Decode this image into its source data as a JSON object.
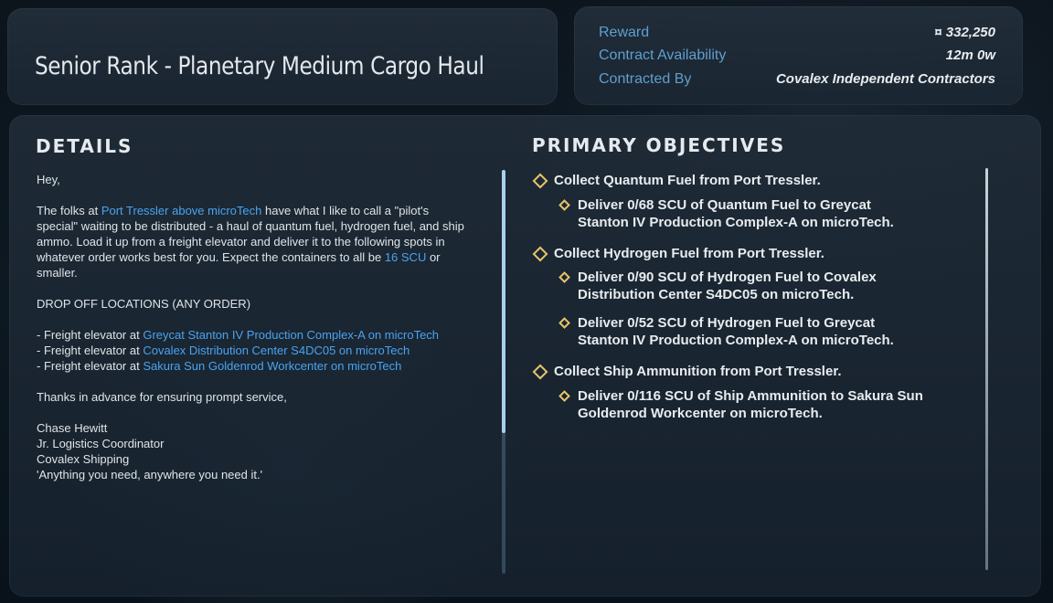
{
  "title": "Senior Rank - Planetary Medium Cargo Haul",
  "info": {
    "reward_label": "Reward",
    "reward_value": "¤ 332,250",
    "availability_label": "Contract Availability",
    "availability_value": "12m 0w",
    "contracted_by_label": "Contracted By",
    "contracted_by_value": "Covalex Independent Contractors"
  },
  "details": {
    "heading": "DETAILS",
    "greeting": "Hey,",
    "p1_a": "The folks at ",
    "p1_link1": "Port Tressler above microTech",
    "p1_b": " have what I like to call a \"pilot's special\" waiting to be distributed - a haul of quantum fuel, hydrogen fuel, and ship ammo. Load it up from a freight elevator and deliver it to the following spots in whatever order works best for you. Expect the containers to all be ",
    "p1_link2": "16 SCU",
    "p1_c": " or smaller.",
    "dropoff_heading": "DROP OFF LOCATIONS (ANY ORDER)",
    "loc_prefix": "- Freight elevator at ",
    "loc1": "Greycat Stanton IV Production Complex-A on microTech",
    "loc2": "Covalex Distribution Center S4DC05 on microTech",
    "loc3": "Sakura Sun Goldenrod Workcenter on microTech",
    "thanks": "Thanks in advance for ensuring prompt service,",
    "sig_name": "Chase Hewitt",
    "sig_title": "Jr. Logistics Coordinator",
    "sig_company": "Covalex Shipping",
    "sig_motto": "'Anything you need, anywhere you need it.'"
  },
  "objectives": {
    "heading": "PRIMARY OBJECTIVES",
    "items": [
      {
        "label": "Collect Quantum Fuel from Port Tressler.",
        "subs": [
          "Deliver 0/68 SCU of Quantum Fuel to Greycat Stanton IV Production Complex-A on microTech."
        ]
      },
      {
        "label": "Collect Hydrogen Fuel from Port Tressler.",
        "subs": [
          "Deliver 0/90 SCU of Hydrogen Fuel to Covalex Distribution Center S4DC05 on microTech.",
          "Deliver 0/52 SCU of Hydrogen Fuel to Greycat Stanton IV Production Complex-A on microTech."
        ]
      },
      {
        "label": "Collect Ship Ammunition from Port Tressler.",
        "subs": [
          "Deliver 0/116 SCU of Ship Ammunition to Sakura Sun Goldenrod Workcenter on microTech."
        ]
      }
    ]
  },
  "colors": {
    "accent_link": "#4aa3f0",
    "label_blue": "#5f9fd0",
    "diamond_gold": "#e8c46a"
  }
}
